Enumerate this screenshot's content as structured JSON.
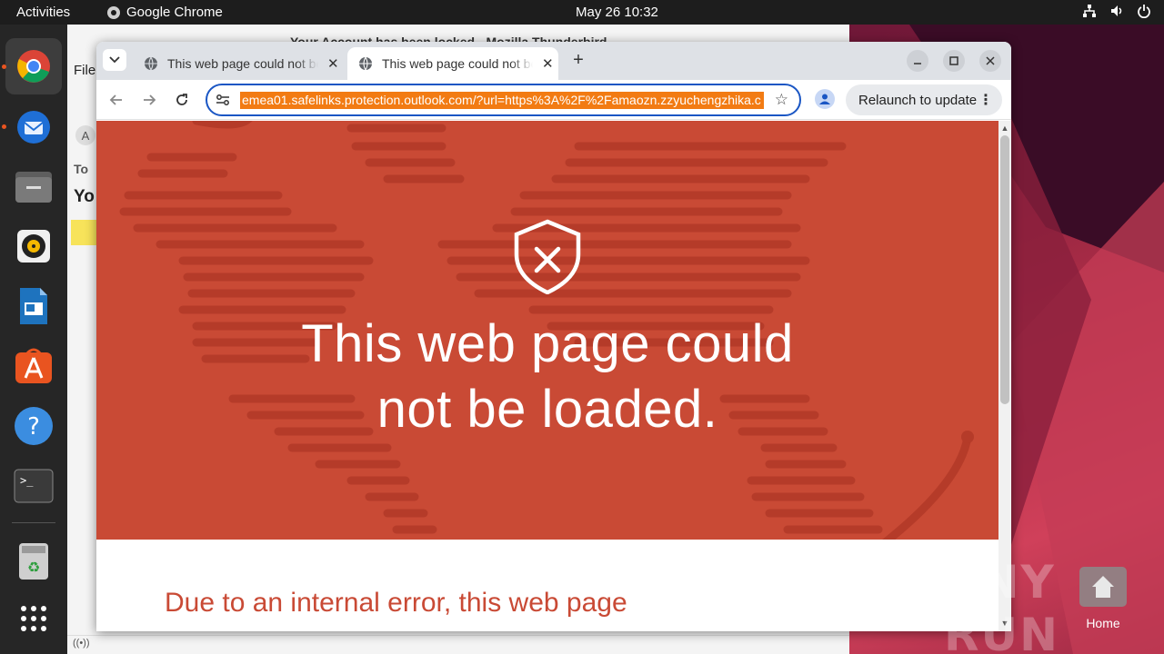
{
  "topbar": {
    "activities": "Activities",
    "app_name": "Google Chrome",
    "clock": "May 26  10:32"
  },
  "dock": {
    "items": [
      "chrome-icon",
      "thunderbird-icon",
      "files-icon",
      "rhythmbox-icon",
      "writer-icon",
      "app-center-icon",
      "help-icon",
      "terminal-icon",
      "trash-icon",
      "show-apps-icon"
    ]
  },
  "thunderbird": {
    "title": "Your Account has been locked - Mozilla Thunderbird",
    "menu_file": "File",
    "to_label": "To",
    "subject_prefix": "Yo",
    "avatar_letter": "A"
  },
  "chrome": {
    "tabs": [
      {
        "title": "This web page could not be loaded.",
        "active": false
      },
      {
        "title": "This web page could not be loaded.",
        "active": true
      }
    ],
    "url": "emea01.safelinks.protection.outlook.com/?url=https%3A%2F%2Famaozn.zzyuchengzhika.c",
    "relaunch_label": "Relaunch to update"
  },
  "page": {
    "hero_line1": "This web page could",
    "hero_line2": "not be loaded.",
    "error_message": "Due to an internal error, this web page"
  },
  "desktop": {
    "home_label": "Home",
    "watermark": "ANY RUN"
  },
  "colors": {
    "hero_bg": "#c94a35",
    "url_highlight": "#f27b13",
    "omnibox_border": "#1a56c4",
    "ubuntu_orange": "#e95420"
  }
}
